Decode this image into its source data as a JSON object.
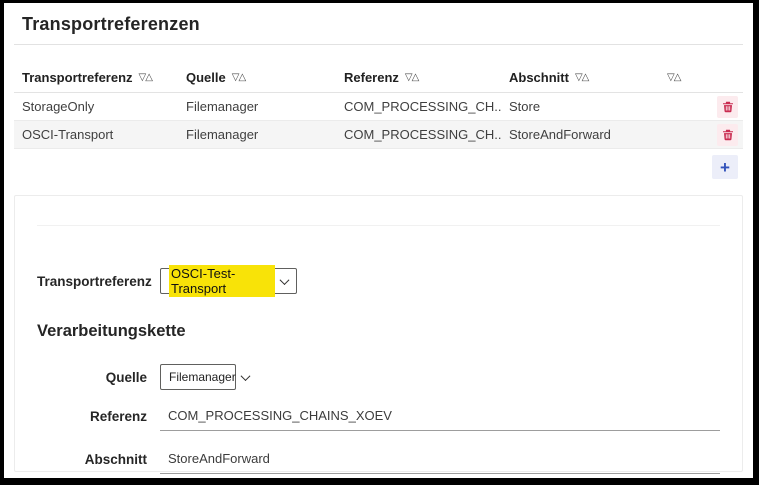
{
  "window": {
    "title": "Transportreferenzen"
  },
  "table": {
    "sort_glyph": "▽△",
    "headers": [
      "Transportreferenz",
      "Quelle",
      "Referenz",
      "Abschnitt"
    ],
    "rows": [
      {
        "transportreferenz": "StorageOnly",
        "quelle": "Filemanager",
        "referenz": "COM_PROCESSING_CH...",
        "abschnitt": "Store"
      },
      {
        "transportreferenz": "OSCI-Transport",
        "quelle": "Filemanager",
        "referenz": "COM_PROCESSING_CH...",
        "abschnitt": "StoreAndForward"
      }
    ],
    "add_button_label": "+"
  },
  "form": {
    "transportreferenz_label": "Transportreferenz",
    "transportreferenz_value": "OSCI-Test-Transport",
    "section_heading": "Verarbeitungskette",
    "quelle_label": "Quelle",
    "quelle_value": "Filemanager",
    "referenz_label": "Referenz",
    "referenz_value": "COM_PROCESSING_CHAINS_XOEV",
    "abschnitt_label": "Abschnitt",
    "abschnitt_value": "StoreAndForward"
  },
  "colors": {
    "highlight_yellow": "#f8e308",
    "delete_red": "#c92b50",
    "delete_bg": "#fcebee",
    "add_blue": "#3353bb",
    "add_bg": "#eceef9",
    "text_dark": "#252525"
  }
}
